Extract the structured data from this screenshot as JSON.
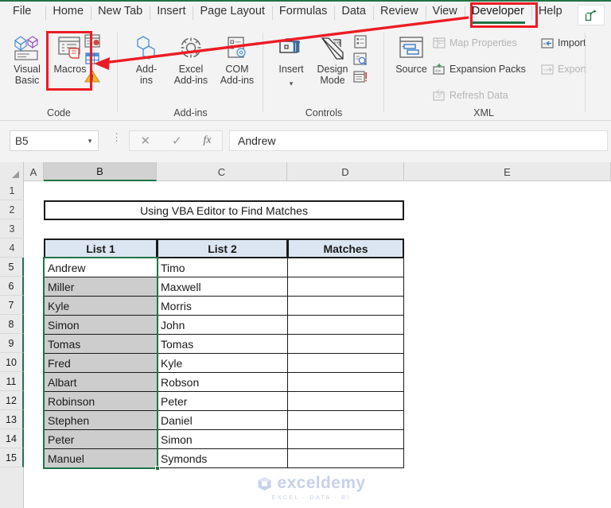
{
  "app": {
    "ribbon_tabs": [
      {
        "label": "File",
        "active": false
      },
      {
        "label": "Home",
        "active": false
      },
      {
        "label": "New Tab",
        "active": false
      },
      {
        "label": "Insert",
        "active": false
      },
      {
        "label": "Page Layout",
        "active": false
      },
      {
        "label": "Formulas",
        "active": false
      },
      {
        "label": "Data",
        "active": false
      },
      {
        "label": "Review",
        "active": false
      },
      {
        "label": "View",
        "active": false
      },
      {
        "label": "Developer",
        "active": true
      },
      {
        "label": "Help",
        "active": false
      }
    ],
    "share_icon": "share-icon",
    "accent_color": "#217346",
    "annotation_color": "#ec1c24"
  },
  "ribbon": {
    "groups": [
      {
        "name": "Code",
        "label": "Code"
      },
      {
        "name": "Add-ins",
        "label": "Add-ins"
      },
      {
        "name": "Controls",
        "label": "Controls"
      },
      {
        "name": "XML",
        "label": "XML"
      }
    ],
    "code": {
      "visual_basic": "Visual Basic",
      "macros": "Macros",
      "record_macro_icon": "record-macro-icon",
      "relative_references_icon": "use-relative-references-icon",
      "macro_security_icon": "macro-security-warning-icon"
    },
    "addins": {
      "add_ins": "Add-\nins",
      "add_ins_l1": "Add-",
      "add_ins_l2": "ins",
      "excel_add_ins_l1": "Excel",
      "excel_add_ins_l2": "Add-ins",
      "com_add_ins_l1": "COM",
      "com_add_ins_l2": "Add-ins"
    },
    "controls": {
      "insert": "Insert",
      "insert_chevron": "chevron-down-icon",
      "design_mode_l1": "Design",
      "design_mode_l2": "Mode",
      "properties_icon": "properties-icon",
      "view_code_icon": "view-code-icon",
      "run_dialog_icon": "run-dialog-icon"
    },
    "xml": {
      "source": "Source",
      "map_properties": "Map Properties",
      "expansion_packs": "Expansion Packs",
      "refresh_data": "Refresh Data",
      "import": "Import",
      "export": "Export"
    }
  },
  "formula_bar": {
    "name_box_value": "B5",
    "cancel_icon": "cancel-icon",
    "enter_icon": "confirm-check-icon",
    "function_icon": "fx",
    "formula_value": "Andrew",
    "menu_dots": "⋮"
  },
  "sheet": {
    "columns": [
      "A",
      "B",
      "C",
      "D",
      "E"
    ],
    "selected_column": "B",
    "rows": [
      "1",
      "2",
      "3",
      "4",
      "5",
      "6",
      "7",
      "8",
      "9",
      "10",
      "11",
      "12",
      "13",
      "14",
      "15"
    ],
    "title_cell": "Using VBA Editor to Find Matches",
    "headers": [
      "List 1",
      "List 2",
      "Matches"
    ],
    "header_fill": "#dce6f2",
    "active_cell": "B5",
    "selection_range": "B5:B15",
    "table": [
      {
        "list1": "Andrew",
        "list2": "Timo",
        "matches": ""
      },
      {
        "list1": "Miller",
        "list2": "Maxwell",
        "matches": ""
      },
      {
        "list1": "Kyle",
        "list2": "Morris",
        "matches": ""
      },
      {
        "list1": "Simon",
        "list2": "John",
        "matches": ""
      },
      {
        "list1": "Tomas",
        "list2": "Tomas",
        "matches": ""
      },
      {
        "list1": "Fred",
        "list2": "Kyle",
        "matches": ""
      },
      {
        "list1": "Albart",
        "list2": "Robson",
        "matches": ""
      },
      {
        "list1": "Robinson",
        "list2": "Peter",
        "matches": ""
      },
      {
        "list1": "Stephen",
        "list2": "Daniel",
        "matches": ""
      },
      {
        "list1": "Peter",
        "list2": "Simon",
        "matches": ""
      },
      {
        "list1": "Manuel",
        "list2": "Symonds",
        "matches": ""
      }
    ]
  },
  "watermark": {
    "brand": "exceldemy",
    "tagline": "EXCEL - DATA - BI",
    "logo_icon": "exceldemy-logo-icon"
  }
}
